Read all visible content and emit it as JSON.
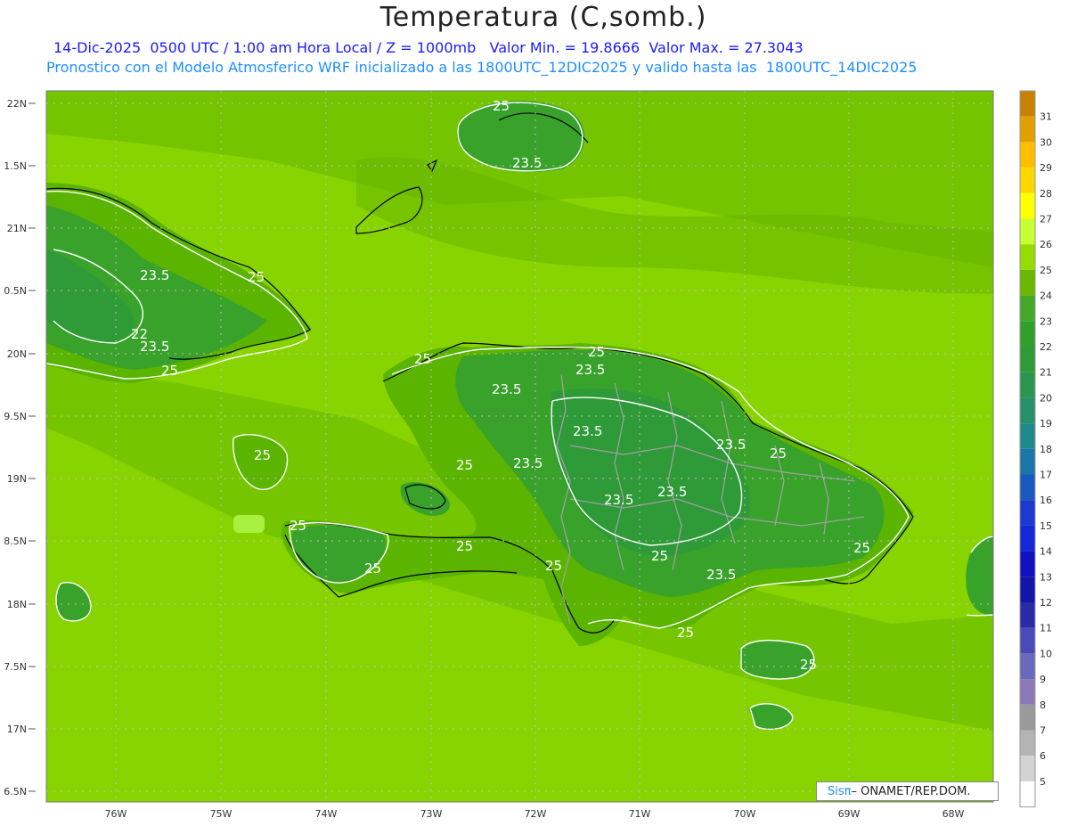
{
  "header": {
    "title": "Temperatura (C,somb.)",
    "line1": "14-Dic-2025  0500 UTC / 1:00 am Hora Local / Z = 1000mb   Valor Min. = 19.8666  Valor Max. = 27.3043",
    "line2": "Pronostico con el Modelo Atmosferico WRF inicializado a las 1800UTC_12DIC2025 y valido hasta las  1800UTC_14DIC2025"
  },
  "axes": {
    "lat_labels": [
      "22N",
      "1.5N",
      "21N",
      "0.5N",
      "20N",
      "9.5N",
      "19N",
      "8.5N",
      "18N",
      "7.5N",
      "17N",
      "6.5N"
    ],
    "lon_labels": [
      "76W",
      "75W",
      "74W",
      "73W",
      "72W",
      "71W",
      "70W",
      "69W",
      "68W"
    ]
  },
  "colorbar": {
    "labels": [
      "31",
      "30",
      "29",
      "28",
      "27",
      "26",
      "25",
      "24",
      "23",
      "22",
      "21",
      "20",
      "19",
      "18",
      "17",
      "16",
      "15",
      "14",
      "13",
      "12",
      "11",
      "10",
      "9",
      "8",
      "7",
      "6",
      "5"
    ],
    "colors": [
      "#c88200",
      "#e1a000",
      "#ffbe00",
      "#ffd700",
      "#ffff00",
      "#c8ff32",
      "#96dc00",
      "#6ab800",
      "#46a828",
      "#31a02b",
      "#2e9a38",
      "#2a9650",
      "#26916a",
      "#1f8a8a",
      "#1a75a8",
      "#1a5ac0",
      "#1a3ad0",
      "#1428d8",
      "#1010c0",
      "#1414a8",
      "#2a2aa8",
      "#4a4ab8",
      "#6a6abc",
      "#8c7ab8",
      "#9a9a9a",
      "#b4b4b4",
      "#d2d2d2",
      "#ffffff"
    ]
  },
  "contour_labels": [
    {
      "text": "25"
    },
    {
      "text": "23.5"
    },
    {
      "text": "23.5"
    },
    {
      "text": "23.5"
    },
    {
      "text": "25"
    },
    {
      "text": "22"
    },
    {
      "text": "23.5"
    },
    {
      "text": "25"
    },
    {
      "text": "25"
    },
    {
      "text": "23.5"
    },
    {
      "text": "25"
    },
    {
      "text": "23.5"
    },
    {
      "text": "25"
    },
    {
      "text": "23.5"
    },
    {
      "text": "23.5"
    },
    {
      "text": "25"
    },
    {
      "text": "23.5"
    },
    {
      "text": "25"
    },
    {
      "text": "25"
    },
    {
      "text": "25"
    },
    {
      "text": "25"
    },
    {
      "text": "25"
    },
    {
      "text": "25"
    },
    {
      "text": "23.5"
    },
    {
      "text": "23.5"
    },
    {
      "text": "25"
    },
    {
      "text": "25"
    }
  ],
  "credit": {
    "sis": "Sisπ",
    "rest": "– ONAMET/REP.DOM."
  },
  "colors": {
    "sea": "#88d400",
    "land_low": "#5ab400",
    "land_mid": "#38a22a",
    "land_high": "#2e9a38",
    "mid": "#72c200"
  }
}
